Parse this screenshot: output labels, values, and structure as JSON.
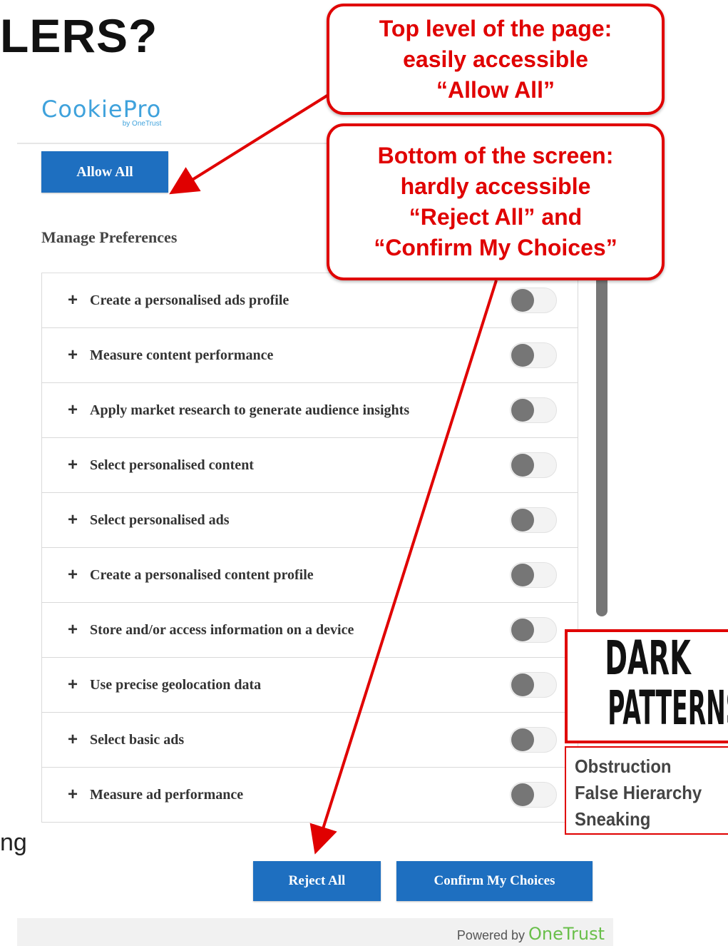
{
  "background": {
    "title_fragment": "LERS?",
    "side_fragment": "ng"
  },
  "logo": {
    "name": "CookiePro",
    "by": "by OneTrust"
  },
  "buttons": {
    "allow_all": "Allow All",
    "reject_all": "Reject All",
    "confirm": "Confirm My Choices"
  },
  "manage_heading": "Manage Preferences",
  "preferences": [
    {
      "label": "Create a personalised ads profile",
      "enabled": false
    },
    {
      "label": "Measure content performance",
      "enabled": false
    },
    {
      "label": "Apply market research to generate audience insights",
      "enabled": false
    },
    {
      "label": "Select personalised content",
      "enabled": false
    },
    {
      "label": "Select personalised ads",
      "enabled": false
    },
    {
      "label": "Create a personalised content profile",
      "enabled": false
    },
    {
      "label": "Store and/or access information on a device",
      "enabled": false
    },
    {
      "label": "Use precise geolocation data",
      "enabled": false
    },
    {
      "label": "Select basic ads",
      "enabled": false
    },
    {
      "label": "Measure ad performance",
      "enabled": false
    }
  ],
  "footer": {
    "powered_by": "Powered by",
    "brand": "OneTrust"
  },
  "callouts": {
    "top": [
      "Top level of the page:",
      "easily accessible",
      "“Allow All”"
    ],
    "bottom": [
      "Bottom of the screen:",
      "hardly accessible",
      "“Reject All” and",
      "“Confirm My Choices”"
    ]
  },
  "dark_patterns": {
    "title_line1": "DARK",
    "title_line2": "PATTERNS",
    "items": [
      "Obstruction",
      "False Hierarchy",
      "Sneaking"
    ]
  },
  "colors": {
    "accent": "#1e6fc0",
    "callout": "#e00000",
    "brand_onetrust": "#69bf4a",
    "brand_cookiepro": "#3fa2dc"
  }
}
